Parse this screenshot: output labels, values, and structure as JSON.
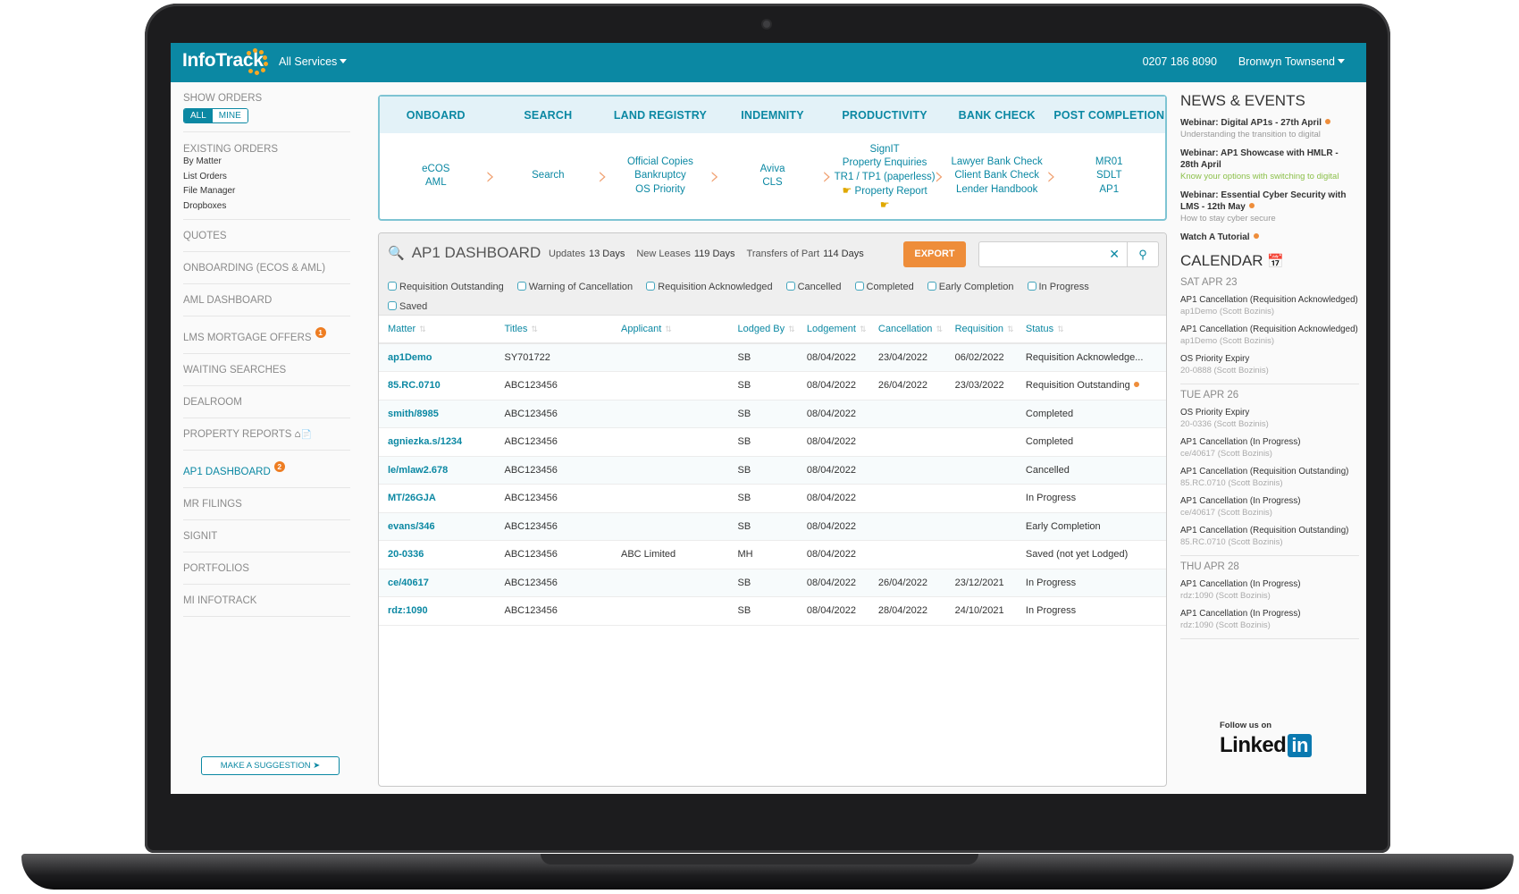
{
  "topbar": {
    "brand": "InfoTrack",
    "services_menu": "All Services",
    "phone": "0207 186 8090",
    "user": "Bronwyn Townsend",
    "colors": {
      "brand": "#0b88a3",
      "accent": "#ee8d3a",
      "logo_dots": "#f7a823"
    }
  },
  "sidebar": {
    "show_orders": {
      "heading": "SHOW ORDERS",
      "options": [
        "ALL",
        "MINE"
      ],
      "selected": "ALL"
    },
    "existing_orders": {
      "heading": "EXISTING ORDERS",
      "links": [
        "By Matter",
        "List Orders",
        "File Manager",
        "Dropboxes"
      ]
    },
    "items": [
      {
        "label": "QUOTES"
      },
      {
        "label": "ONBOARDING (ECOS & AML)"
      },
      {
        "label": "AML DASHBOARD"
      },
      {
        "label": "LMS MORTGAGE OFFERS",
        "badge": "1"
      },
      {
        "label": "WAITING SEARCHES"
      },
      {
        "label": "DEALROOM"
      },
      {
        "label": "PROPERTY REPORTS",
        "icons": [
          "house-icon",
          "document-icon"
        ]
      },
      {
        "label": "AP1 DASHBOARD",
        "badge": "2",
        "active": true
      },
      {
        "label": "MR FILINGS"
      },
      {
        "label": "SIGNIT"
      },
      {
        "label": "PORTFOLIOS"
      },
      {
        "label": "MI INFOTRACK"
      }
    ],
    "suggestion_button": "MAKE A SUGGESTION"
  },
  "service_flow": {
    "columns": [
      {
        "title": "ONBOARD",
        "links": [
          "eCOS",
          "AML"
        ]
      },
      {
        "title": "SEARCH",
        "links": [
          "Search"
        ]
      },
      {
        "title": "LAND REGISTRY",
        "links": [
          "Official Copies",
          "Bankruptcy",
          "OS Priority"
        ]
      },
      {
        "title": "INDEMNITY",
        "links": [
          "Aviva",
          "CLS"
        ]
      },
      {
        "title": "PRODUCTIVITY",
        "links": [
          "SignIT",
          "Property Enquiries",
          "TR1 / TP1 (paperless)",
          "Property Report"
        ]
      },
      {
        "title": "BANK CHECK",
        "links": [
          "Lawyer Bank Check",
          "Client Bank Check",
          "Lender Handbook"
        ]
      },
      {
        "title": "POST COMPLETION",
        "links": [
          "MR01",
          "SDLT",
          "AP1"
        ]
      }
    ]
  },
  "dashboard": {
    "title": "AP1 DASHBOARD",
    "counts": [
      {
        "label": "Updates",
        "value": "13 Days"
      },
      {
        "label": "New Leases",
        "value": "119 Days"
      },
      {
        "label": "Transfers of Part",
        "value": "114 Days"
      }
    ],
    "export_label": "EXPORT",
    "search": {
      "value": "",
      "placeholder": ""
    },
    "filters": [
      "Requisition Outstanding",
      "Warning of Cancellation",
      "Requisition Acknowledged",
      "Cancelled",
      "Completed",
      "Early Completion",
      "In Progress",
      "Saved"
    ],
    "columns": [
      "Matter",
      "Titles",
      "Applicant",
      "Lodged By",
      "Lodgement",
      "Cancellation",
      "Requisition",
      "Status"
    ],
    "rows": [
      {
        "matter": "ap1Demo",
        "titles": "SY701722",
        "applicant": "",
        "lodged_by": "SB",
        "lodgement": "08/04/2022",
        "cancellation": "23/04/2022",
        "requisition": "06/02/2022",
        "status": "Requisition Acknowledge..."
      },
      {
        "matter": "85.RC.0710",
        "titles": "ABC123456",
        "applicant": "",
        "lodged_by": "SB",
        "lodgement": "08/04/2022",
        "cancellation": "26/04/2022",
        "requisition": "23/03/2022",
        "status": "Requisition Outstanding",
        "alert": true
      },
      {
        "matter": "smith/8985",
        "titles": "ABC123456",
        "applicant": "",
        "lodged_by": "SB",
        "lodgement": "08/04/2022",
        "cancellation": "",
        "requisition": "",
        "status": "Completed"
      },
      {
        "matter": "agniezka.s/1234",
        "titles": "ABC123456",
        "applicant": "",
        "lodged_by": "SB",
        "lodgement": "08/04/2022",
        "cancellation": "",
        "requisition": "",
        "status": "Completed"
      },
      {
        "matter": "le/mlaw2.678",
        "titles": "ABC123456",
        "applicant": "",
        "lodged_by": "SB",
        "lodgement": "08/04/2022",
        "cancellation": "",
        "requisition": "",
        "status": "Cancelled"
      },
      {
        "matter": "MT/26GJA",
        "titles": "ABC123456",
        "applicant": "",
        "lodged_by": "SB",
        "lodgement": "08/04/2022",
        "cancellation": "",
        "requisition": "",
        "status": "In Progress"
      },
      {
        "matter": "evans/346",
        "titles": "ABC123456",
        "applicant": "",
        "lodged_by": "SB",
        "lodgement": "08/04/2022",
        "cancellation": "",
        "requisition": "",
        "status": "Early Completion"
      },
      {
        "matter": "20-0336",
        "titles": "ABC123456",
        "applicant": "ABC Limited",
        "lodged_by": "MH",
        "lodgement": "08/04/2022",
        "cancellation": "",
        "requisition": "",
        "status": "Saved (not yet Lodged)"
      },
      {
        "matter": "ce/40617",
        "titles": "ABC123456",
        "applicant": "",
        "lodged_by": "SB",
        "lodgement": "08/04/2022",
        "cancellation": "26/04/2022",
        "requisition": "23/12/2021",
        "status": "In Progress"
      },
      {
        "matter": "rdz:1090",
        "titles": "ABC123456",
        "applicant": "",
        "lodged_by": "SB",
        "lodgement": "08/04/2022",
        "cancellation": "28/04/2022",
        "requisition": "24/10/2021",
        "status": "In Progress"
      }
    ]
  },
  "news": {
    "heading": "NEWS & EVENTS",
    "items": [
      {
        "title": "Webinar: Digital AP1s - 27th April",
        "sub": "Understanding the transition to digital",
        "dot": true
      },
      {
        "title": "Webinar: AP1 Showcase with HMLR - 28th April",
        "sub": "Know your options with switching to digital",
        "sub_green": true
      },
      {
        "title": "Webinar: Essential Cyber Security with LMS - 12th May",
        "sub": "How to stay cyber secure",
        "dot": true
      },
      {
        "title": "Watch A Tutorial",
        "sub": "",
        "dot": true
      }
    ]
  },
  "calendar": {
    "heading": "CALENDAR",
    "days": [
      {
        "day": "SAT APR 23",
        "events": [
          {
            "title": "AP1 Cancellation (Requisition Acknowledged)",
            "sub": "ap1Demo (Scott Bozinis)"
          },
          {
            "title": "AP1 Cancellation (Requisition Acknowledged)",
            "sub": "ap1Demo (Scott Bozinis)"
          },
          {
            "title": "OS Priority Expiry",
            "sub": "20-0888 (Scott Bozinis)"
          }
        ]
      },
      {
        "day": "TUE APR 26",
        "events": [
          {
            "title": "OS Priority Expiry",
            "sub": "20-0336 (Scott Bozinis)"
          },
          {
            "title": "AP1 Cancellation (In Progress)",
            "sub": "ce/40617 (Scott Bozinis)"
          },
          {
            "title": "AP1 Cancellation (Requisition Outstanding)",
            "sub": "85.RC.0710 (Scott Bozinis)"
          },
          {
            "title": "AP1 Cancellation (In Progress)",
            "sub": "ce/40617 (Scott Bozinis)"
          },
          {
            "title": "AP1 Cancellation (Requisition Outstanding)",
            "sub": "85.RC.0710 (Scott Bozinis)"
          }
        ]
      },
      {
        "day": "THU APR 28",
        "events": [
          {
            "title": "AP1 Cancellation (In Progress)",
            "sub": "rdz:1090 (Scott Bozinis)"
          },
          {
            "title": "AP1 Cancellation (In Progress)",
            "sub": "rdz:1090 (Scott Bozinis)"
          }
        ]
      }
    ]
  },
  "social": {
    "follow_label": "Follow us on",
    "brand_text": "Linked",
    "brand_badge": "in"
  }
}
